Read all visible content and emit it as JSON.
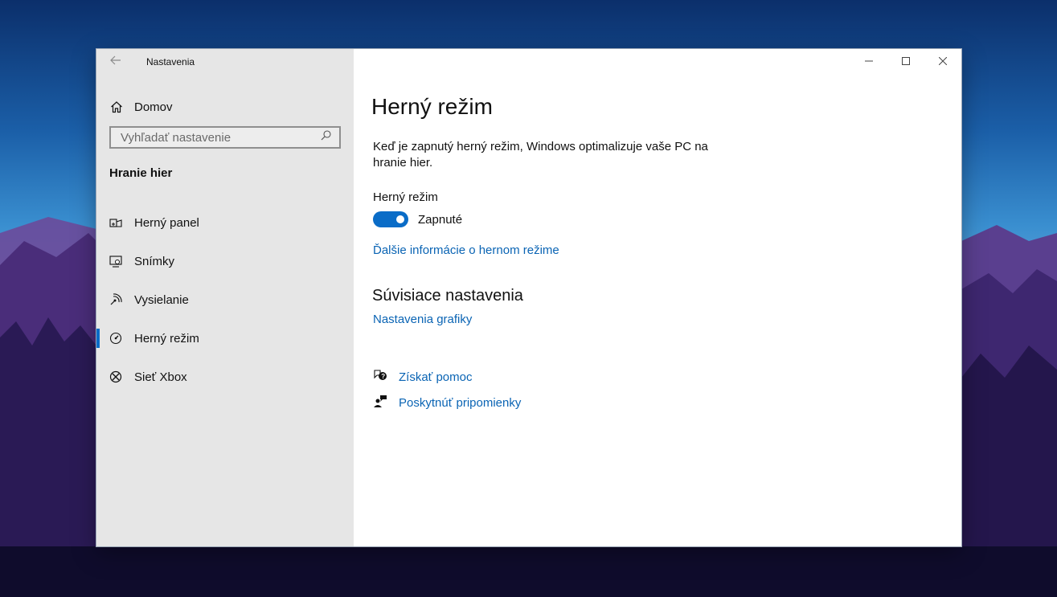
{
  "window": {
    "app_title": "Nastavenia"
  },
  "sidebar": {
    "home_label": "Domov",
    "search_placeholder": "Vyhľadať nastavenie",
    "section_title": "Hranie hier",
    "items": [
      {
        "label": "Herný panel",
        "icon": "game-bar-icon",
        "active": false
      },
      {
        "label": "Snímky",
        "icon": "captures-icon",
        "active": false
      },
      {
        "label": "Vysielanie",
        "icon": "broadcasting-icon",
        "active": false
      },
      {
        "label": "Herný režim",
        "icon": "game-mode-icon",
        "active": true
      },
      {
        "label": "Sieť Xbox",
        "icon": "xbox-icon",
        "active": false
      }
    ]
  },
  "main": {
    "title": "Herný režim",
    "description": "Keď je zapnutý herný režim, Windows optimalizuje vaše PC na hranie hier.",
    "setting_label": "Herný režim",
    "toggle_state": "Zapnuté",
    "toggle_on": true,
    "more_info_link": "Ďalšie informácie o hernom režime",
    "related_title": "Súvisiace nastavenia",
    "graphics_link": "Nastavenia grafiky",
    "help_link": "Získať pomoc",
    "feedback_link": "Poskytnúť pripomienky"
  },
  "colors": {
    "accent": "#0a6cc7",
    "link": "#0a64b4",
    "sidebar_bg": "#e6e6e6"
  }
}
